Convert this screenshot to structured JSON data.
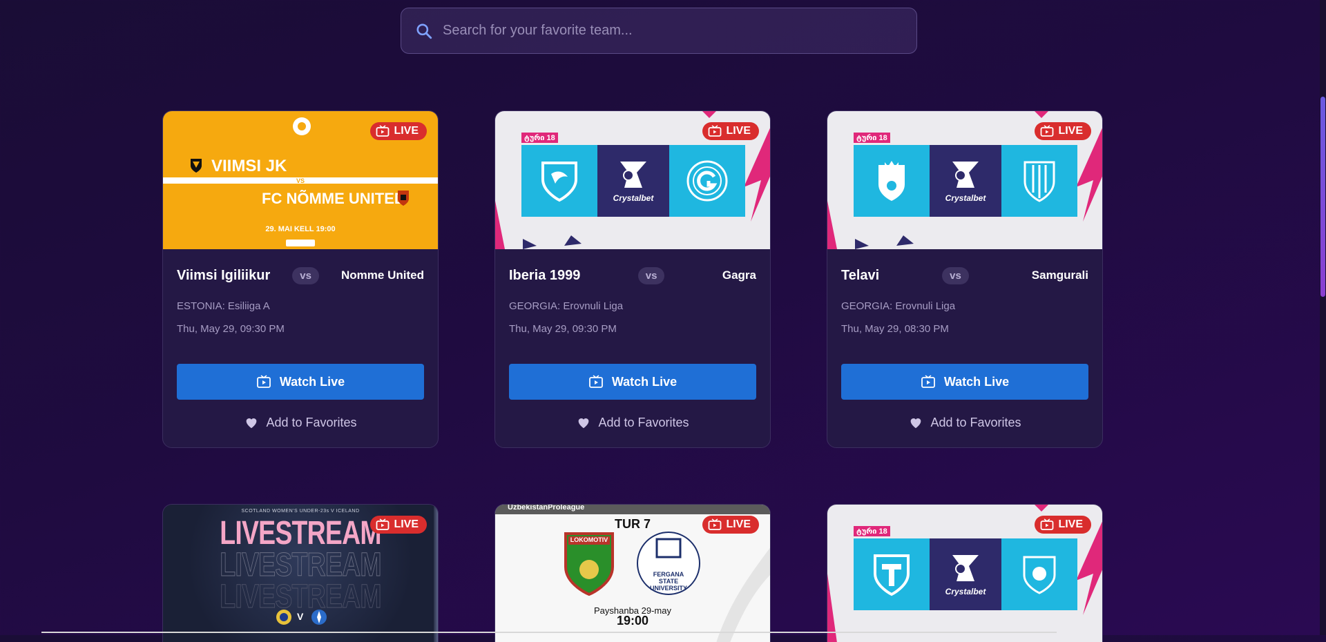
{
  "search": {
    "placeholder": "Search for your favorite team..."
  },
  "colors": {
    "accent": "#1f6fd6",
    "live": "#d92d2d",
    "card": "#241845"
  },
  "live_label": "LIVE",
  "matches": [
    {
      "home": "Viimsi Igiliikur",
      "vs": "vs",
      "away": "Nomme United",
      "league": "ESTONIA: Esiliiga A",
      "time": "Thu, May 29, 09:30 PM",
      "watch": "Watch Live",
      "fav": "Add to Favorites",
      "thumb": {
        "home": "VIIMSI JK",
        "vs": "VS",
        "away": "FC NÕMME UNITED",
        "date": "29. MAI KELL 19:00"
      }
    },
    {
      "home": "Iberia 1999",
      "vs": "vs",
      "away": "Gagra",
      "league": "GEORGIA: Erovnuli Liga",
      "time": "Thu, May 29, 09:30 PM",
      "watch": "Watch Live",
      "fav": "Add to Favorites",
      "thumb": {
        "tag": "ტური 18",
        "sponsor": "Crystalbet"
      }
    },
    {
      "home": "Telavi",
      "vs": "vs",
      "away": "Samgurali",
      "league": "GEORGIA: Erovnuli Liga",
      "time": "Thu, May 29, 08:30 PM",
      "watch": "Watch Live",
      "fav": "Add to Favorites",
      "thumb": {
        "tag": "ტური 18",
        "sponsor": "Crystalbet"
      }
    },
    {
      "thumb": {
        "top": "SCOTLAND WOMEN'S UNDER-23s V ICELAND",
        "word": "LIVESTREAM",
        "v": "V"
      }
    },
    {
      "thumb": {
        "league": "UzbekistanProleague",
        "round": "TUR 7",
        "left": "LOKOMOTIV",
        "right": "FERGANA STATE UNIVERSITY",
        "day": "Payshanba 29-may",
        "time": "19:00"
      }
    },
    {
      "thumb": {
        "tag": "ტური 18",
        "sponsor": "Crystalbet"
      }
    }
  ]
}
